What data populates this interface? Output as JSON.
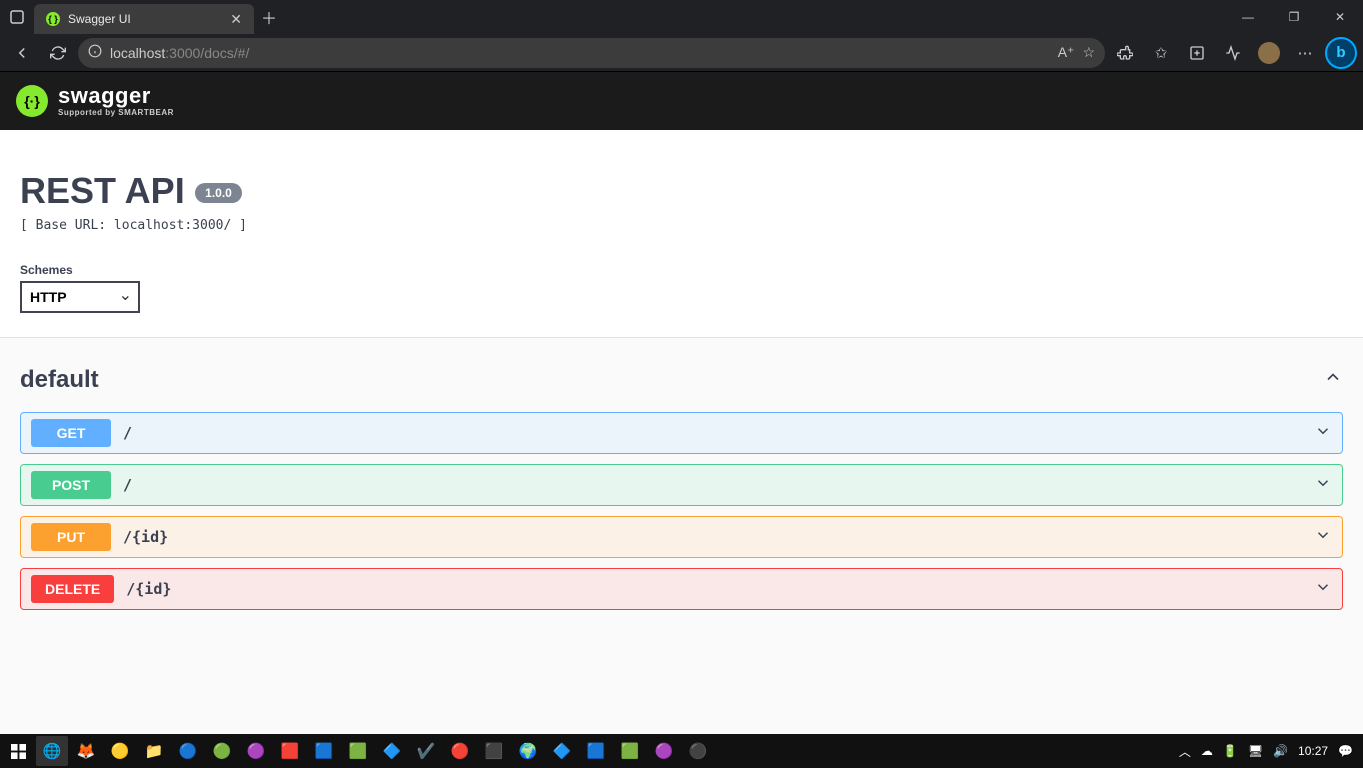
{
  "browser": {
    "tab_title": "Swagger UI",
    "url_host": "localhost",
    "url_port_path": ":3000/docs/#/"
  },
  "swagger": {
    "brand": "swagger",
    "supported_by": "Supported by SMARTBEAR"
  },
  "api": {
    "title": "REST API",
    "version": "1.0.0",
    "base_url_label": "[ Base URL: localhost:3000/ ]"
  },
  "schemes": {
    "label": "Schemes",
    "selected": "HTTP"
  },
  "tag": {
    "name": "default"
  },
  "ops": [
    {
      "method": "GET",
      "path": "/",
      "cls": "op-get"
    },
    {
      "method": "POST",
      "path": "/",
      "cls": "op-post"
    },
    {
      "method": "PUT",
      "path": "/{id}",
      "cls": "op-put"
    },
    {
      "method": "DELETE",
      "path": "/{id}",
      "cls": "op-delete"
    }
  ],
  "system": {
    "clock": "10:27"
  }
}
